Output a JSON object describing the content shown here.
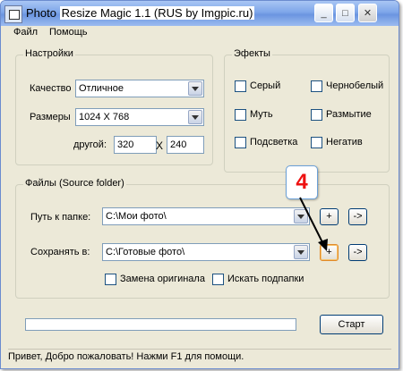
{
  "window": {
    "title_prefix": "Photo",
    "title_highlight": "Resize Magic 1.1 (RUS by Imgpic.ru)",
    "min_glyph": "_",
    "max_glyph": "□",
    "close_glyph": "✕"
  },
  "menu": [
    "Файл",
    "Помощь"
  ],
  "settings": {
    "legend": "Настройки",
    "quality_label": "Качество",
    "quality_value": "Отличное",
    "size_label": "Размеры",
    "size_value": "1024 X 768",
    "other_label": "другой:",
    "width_value": "320",
    "x_sep": "X",
    "height_value": "240"
  },
  "effects": {
    "legend": "Эфекты",
    "items": [
      "Серый",
      "Чернобелый",
      "Муть",
      "Размытие",
      "Подсветка",
      "Негатив"
    ]
  },
  "files": {
    "legend": "Файлы (Source folder)",
    "path_label": "Путь к папке:",
    "path_value": "C:\\Мои фото\\",
    "save_label": "Сохранять в:",
    "save_value": "C:\\Готовые фото\\",
    "plus": "+",
    "arrow": "->",
    "replace_original": "Замена оригинала",
    "search_subfolders": "Искать подпапки"
  },
  "progress": 0,
  "start_label": "Старт",
  "status_text": "Привет, Добро пожаловать! Нажми F1 для помощи.",
  "annotation": "4",
  "colors": {
    "accent": "#e08a2a",
    "annotation": "#ee1111",
    "titlebar": "#7ea6e9",
    "window_bg": "#ece9d8"
  }
}
